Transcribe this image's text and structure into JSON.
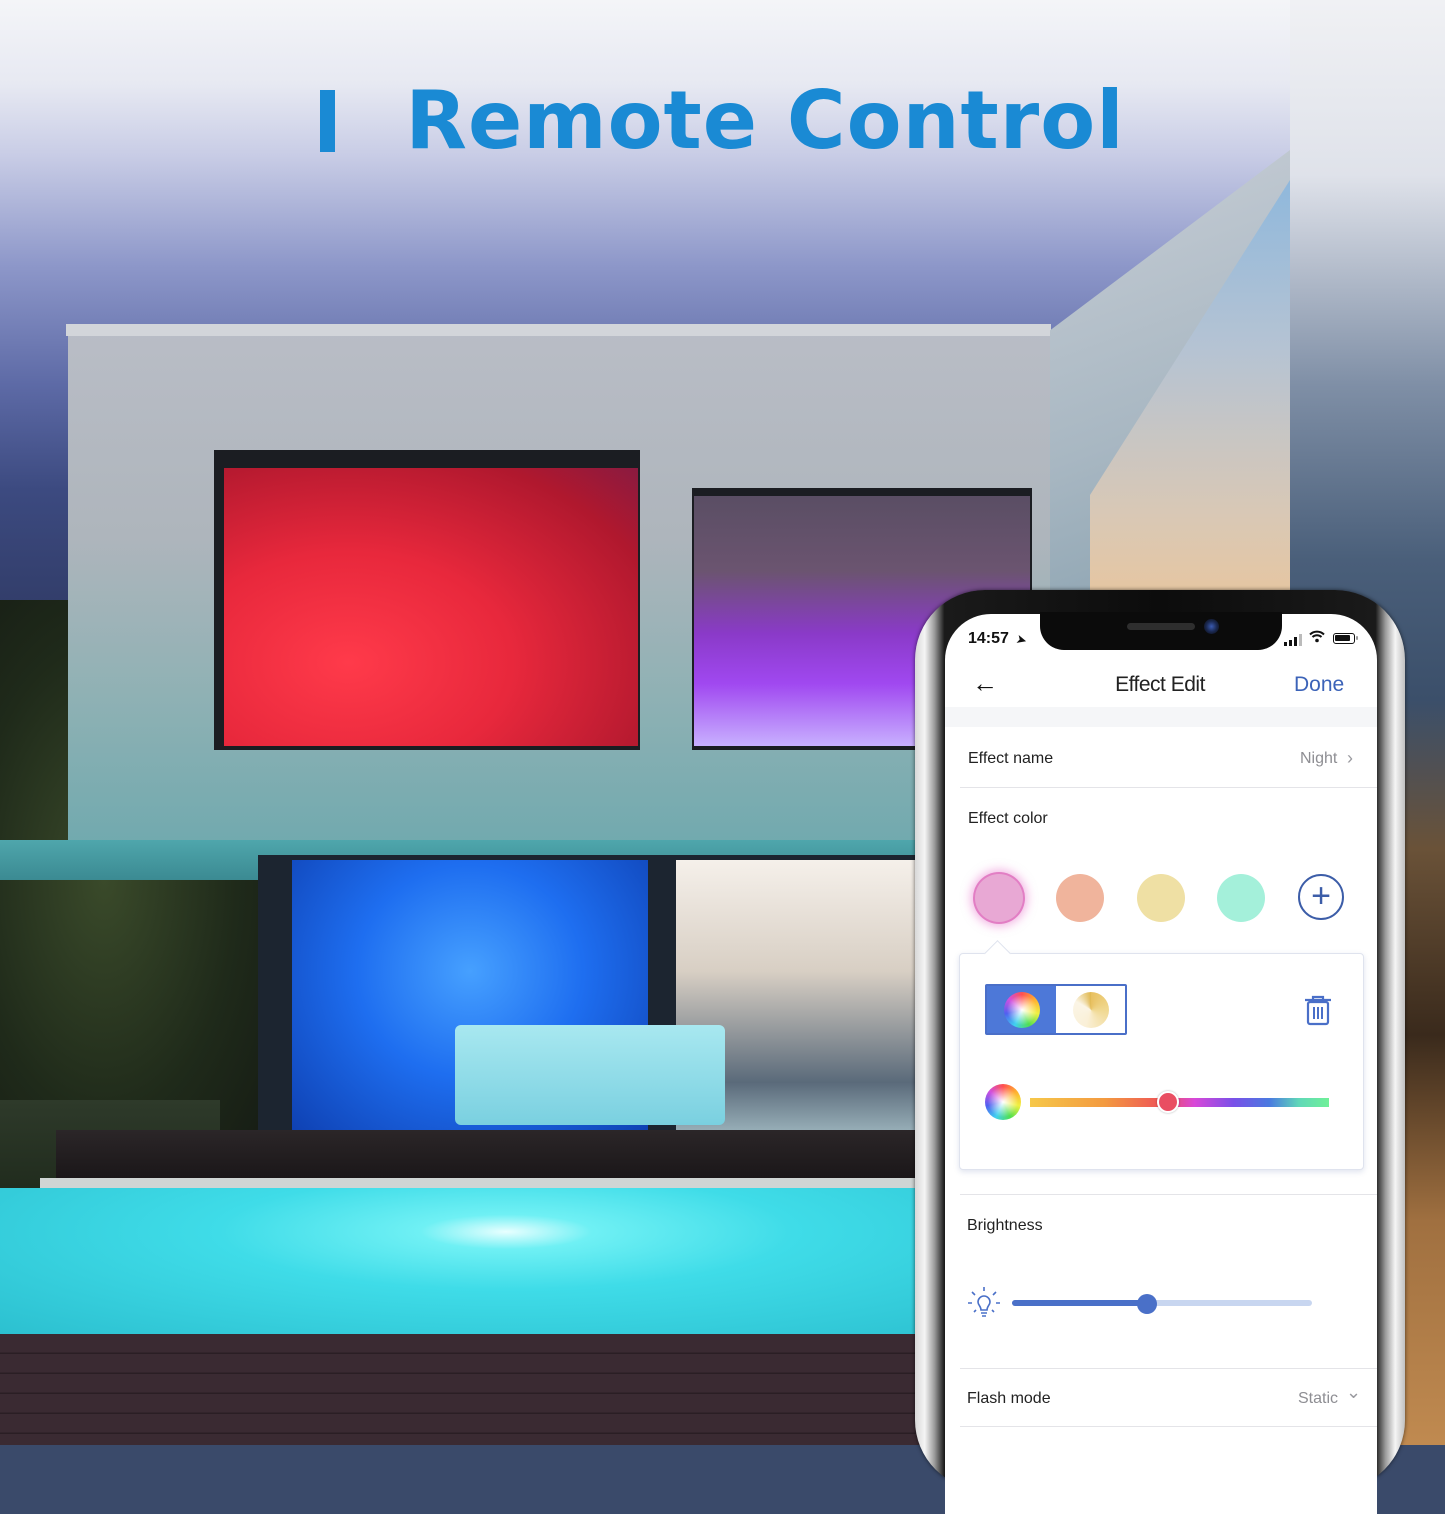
{
  "headline": {
    "title": "Remote Control",
    "color": "#1a8ad4"
  },
  "phone": {
    "status_bar": {
      "time": "14:57",
      "location_icon": "location-arrow-icon",
      "signal_icon": "signal-bars-icon",
      "wifi_icon": "wifi-icon",
      "battery_icon": "battery-icon"
    },
    "nav": {
      "back_icon": "←",
      "title": "Effect Edit",
      "done_label": "Done",
      "accent": "#3c63b8"
    },
    "effect_name": {
      "label": "Effect name",
      "value": "Night",
      "chevron": "›"
    },
    "effect_color": {
      "label": "Effect color",
      "swatches": [
        {
          "name": "pink",
          "color": "#e8a8d4",
          "selected": true
        },
        {
          "name": "salmon",
          "color": "#f0b49c",
          "selected": false
        },
        {
          "name": "yellow",
          "color": "#efe0a4",
          "selected": false
        },
        {
          "name": "mint",
          "color": "#a4f0da",
          "selected": false
        }
      ],
      "add_icon": "+"
    },
    "color_popover": {
      "modes": [
        {
          "name": "color-wheel",
          "active": true
        },
        {
          "name": "white-temperature",
          "active": false
        }
      ],
      "trash_icon": "trash-icon",
      "hue_position_fraction": 0.46,
      "selected_hue_color": "#e94e62"
    },
    "brightness": {
      "label": "Brightness",
      "value_fraction": 0.45
    },
    "flash_mode": {
      "label": "Flash mode",
      "value": "Static",
      "chevron": "⌄"
    }
  }
}
